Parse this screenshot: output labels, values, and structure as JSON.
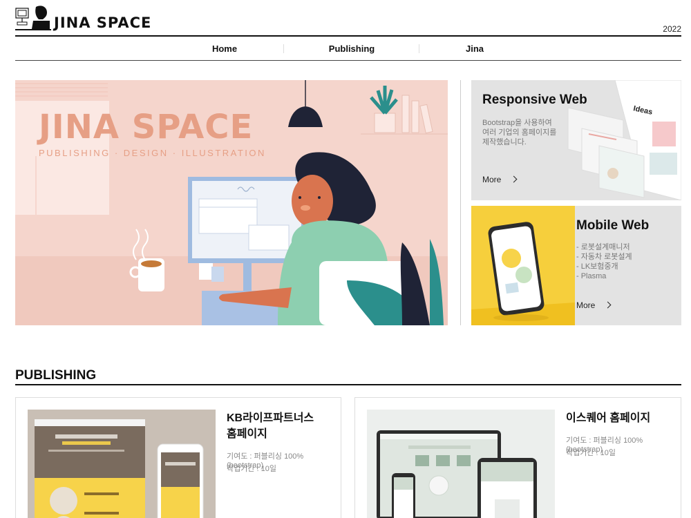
{
  "brand": {
    "name": "JINA SPACE",
    "year": "2022"
  },
  "nav": {
    "items": [
      "Home",
      "Publishing",
      "Jina"
    ]
  },
  "hero": {
    "title": "JINA SPACE",
    "subtitle": "PUBLISHING · DESIGN · ILLUSTRATION"
  },
  "cards": {
    "responsive": {
      "title": "Responsive Web",
      "desc": [
        "Bootstrap을 사용하여",
        "여러 기업의 홈페이지를",
        "제작했습니다."
      ],
      "more": "More",
      "mockup_label": "Ideas"
    },
    "mobile": {
      "title": "Mobile Web",
      "desc": [
        "- 로봇설계매니저",
        "- 자동차 로봇설계",
        "- LK보험중개",
        "- Plasma"
      ],
      "more": "More"
    }
  },
  "publishing": {
    "title": "PUBLISHING",
    "projects": [
      {
        "title_lines": [
          "KB라이프파트너스",
          "홈페이지"
        ],
        "contribution": "기여도 : 퍼블리싱 100% (bootstrap)",
        "period": "작업기간 : 10일"
      },
      {
        "title_lines": [
          "이스퀘어 홈페이지"
        ],
        "contribution": "기여도 : 퍼블리싱 100% (bootstrap)",
        "period": "작업기간 : 10일"
      }
    ]
  },
  "colors": {
    "hero_bg": "#f5d5cc",
    "hero_accent": "#e69f85",
    "mobile_yellow": "#f5c92e",
    "card_bg": "#e3e3e3"
  }
}
